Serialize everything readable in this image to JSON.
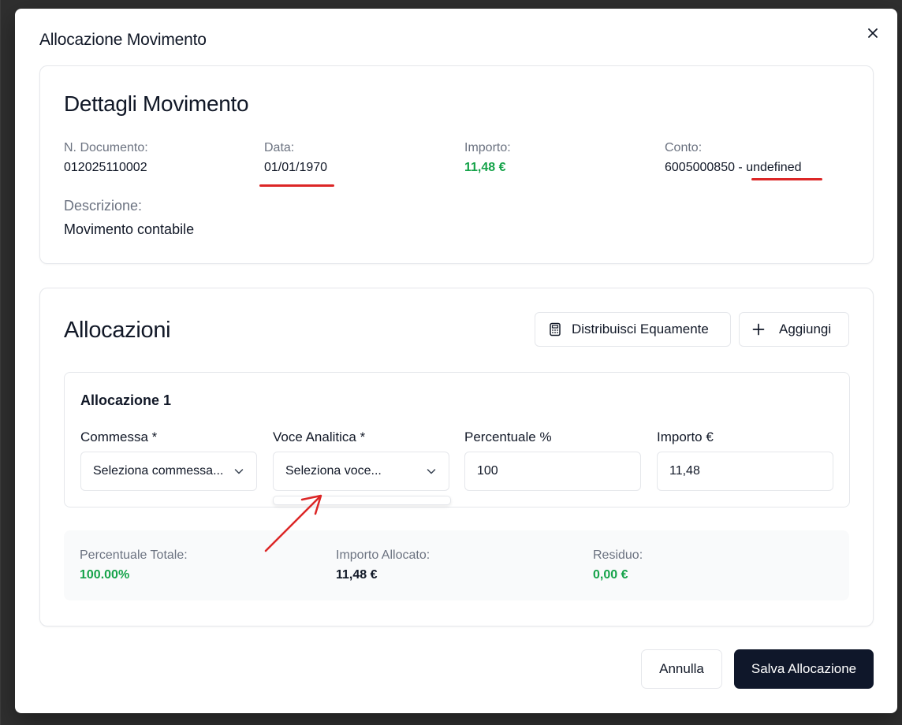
{
  "modal": {
    "title": "Allocazione Movimento"
  },
  "details": {
    "title": "Dettagli Movimento",
    "doc_label": "N. Documento:",
    "doc_value": "012025110002",
    "date_label": "Data:",
    "date_value": "01/01/1970",
    "amount_label": "Importo:",
    "amount_value": "11,48 €",
    "account_label": "Conto:",
    "account_value": "6005000850 - undefined",
    "desc_label": "Descrizione:",
    "desc_value": "Movimento contabile"
  },
  "allocations": {
    "title": "Allocazioni",
    "distribute_label": "Distribuisci Equamente",
    "add_label": "Aggiungi",
    "items": [
      {
        "title": "Allocazione 1",
        "commessa_label": "Commessa *",
        "commessa_placeholder": "Seleziona commessa...",
        "voce_label": "Voce Analitica *",
        "voce_placeholder": "Seleziona voce...",
        "percent_label": "Percentuale %",
        "percent_value": "100",
        "amount_label": "Importo €",
        "amount_value": "11,48"
      }
    ]
  },
  "summary": {
    "total_percent_label": "Percentuale Totale:",
    "total_percent_value": "100.00%",
    "allocated_label": "Importo Allocato:",
    "allocated_value": "11,48 €",
    "residual_label": "Residuo:",
    "residual_value": "0,00 €"
  },
  "footer": {
    "cancel_label": "Annulla",
    "save_label": "Salva Allocazione"
  },
  "colors": {
    "accent_green": "#16a34a",
    "annotation_red": "#dc2626",
    "primary_dark": "#0f172a"
  },
  "icons": [
    "close-icon",
    "calculator-icon",
    "plus-icon",
    "chevron-down-icon"
  ]
}
